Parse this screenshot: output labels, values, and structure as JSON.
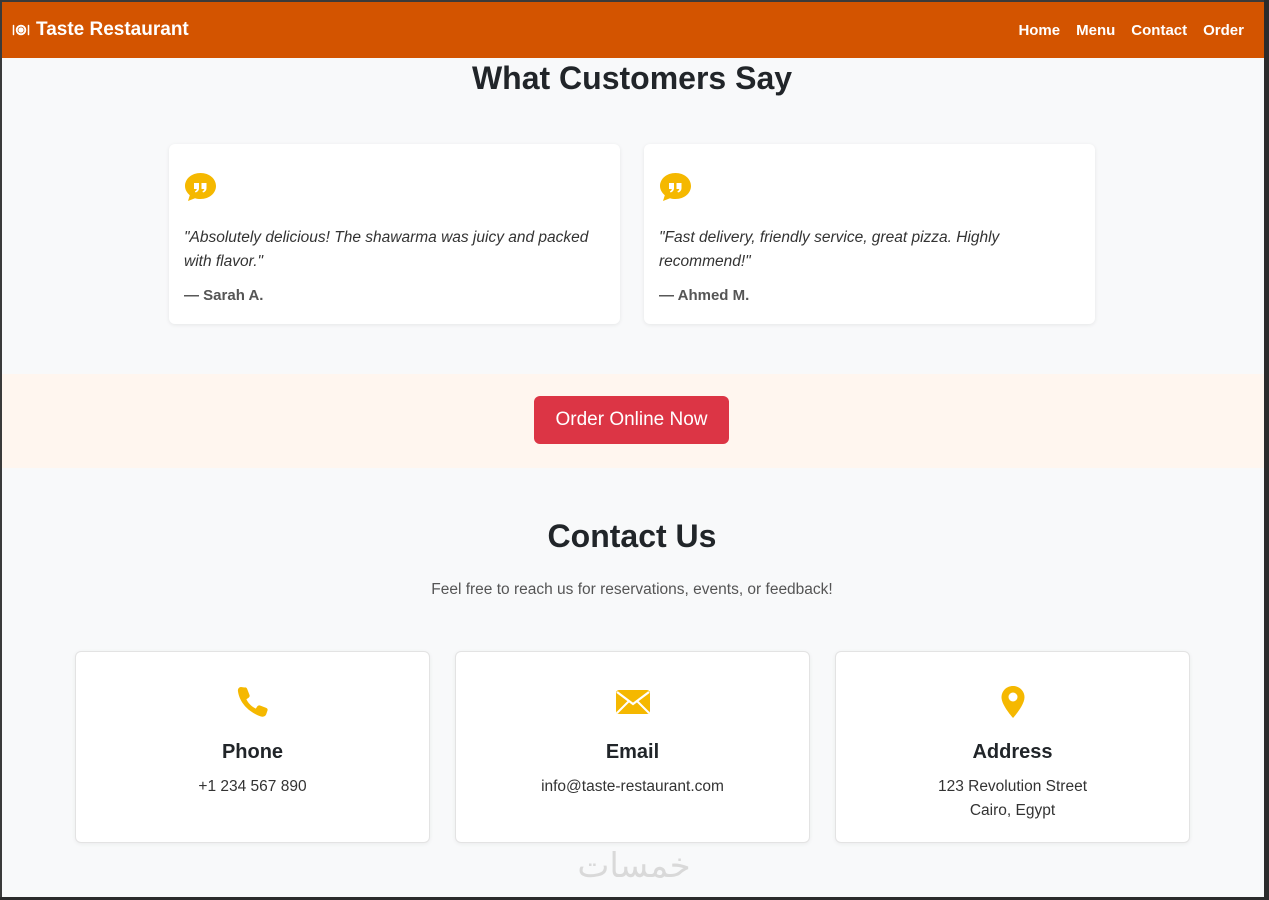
{
  "navbar": {
    "brand": "Taste Restaurant",
    "brand_icon": "plate-cutlery-icon",
    "links": [
      "Home",
      "Menu",
      "Contact",
      "Order"
    ],
    "bg_color": "#d35400"
  },
  "testimonials": {
    "title": "What Customers Say",
    "items": [
      {
        "quote": "\"Absolutely delicious! The shawarma was juicy and packed with flavor.\"",
        "author": "— Sarah A."
      },
      {
        "quote": "\"Fast delivery, friendly service, great pizza. Highly recommend!\"",
        "author": "— Ahmed M."
      }
    ],
    "icon_color": "#f5b800"
  },
  "cta": {
    "label": "Order Online Now",
    "color": "#dc3545"
  },
  "contact": {
    "title": "Contact Us",
    "subtitle": "Feel free to reach us for reservations, events, or feedback!",
    "cards": [
      {
        "icon": "phone-icon",
        "heading": "Phone",
        "line1": "+1 234 567 890",
        "line2": ""
      },
      {
        "icon": "envelope-icon",
        "heading": "Email",
        "line1": "info@taste-restaurant.com",
        "line2": ""
      },
      {
        "icon": "map-pin-icon",
        "heading": "Address",
        "line1": "123 Revolution Street",
        "line2": "Cairo, Egypt"
      }
    ]
  },
  "watermark": "خمسات"
}
